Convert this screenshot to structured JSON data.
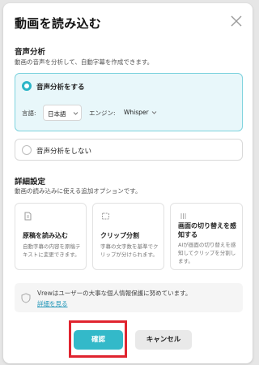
{
  "dialog": {
    "title": "動画を読み込む"
  },
  "speech_analysis": {
    "title": "音声分析",
    "description": "動画の音声を分析して、自動字幕を作成できます。",
    "option_on_label": "音声分析をする",
    "language_label": "言語:",
    "language_value": "日本語",
    "engine_label": "エンジン:",
    "engine_value": "Whisper",
    "option_off_label": "音声分析をしない"
  },
  "details": {
    "title": "詳細設定",
    "description": "動画の読み込みに使える追加オプションです。",
    "cards": [
      {
        "icon": "document-icon",
        "title": "原稿を読み込む",
        "description": "自動字幕の内容を原稿テキストに変更できます。"
      },
      {
        "icon": "split-icon",
        "title": "クリップ分割",
        "description": "字幕の文字数を基準でクリップが分けられます。"
      },
      {
        "icon": "scene-icon",
        "title": "画面の切り替えを感知する",
        "description": "AIが画面の切り替えを感知してクリップを分割します。"
      }
    ]
  },
  "privacy": {
    "text": "Vrewはユーザーの大事な個人情報保護に努めています。",
    "link": "詳細を見る"
  },
  "buttons": {
    "confirm": "確認",
    "cancel": "キャンセル"
  },
  "colors": {
    "accent": "#33b9c9",
    "selected_bg": "#e8f7fa",
    "highlight": "#e0242f"
  }
}
